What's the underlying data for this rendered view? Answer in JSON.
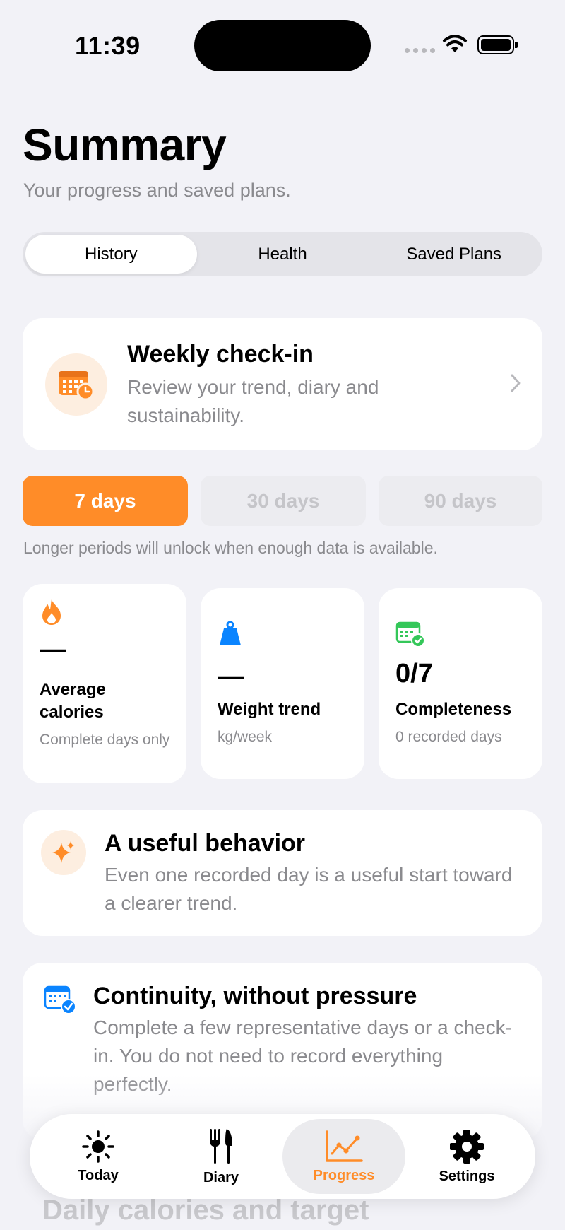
{
  "status_bar": {
    "time": "11:39"
  },
  "header": {
    "title": "Summary",
    "subtitle": "Your progress and saved plans."
  },
  "segments": [
    "History",
    "Health",
    "Saved Plans"
  ],
  "segment_selected": "History",
  "checkin": {
    "title": "Weekly check-in",
    "description": "Review your trend, diary and sustainability.",
    "icon": "calendar-clock-icon"
  },
  "periods": {
    "options": [
      "7 days",
      "30 days",
      "90 days"
    ],
    "selected": "7 days",
    "note": "Longer periods will unlock when enough data is available."
  },
  "stats": [
    {
      "icon": "flame-icon",
      "value": "—",
      "label": "Average calories",
      "sub": "Complete days only"
    },
    {
      "icon": "weight-icon",
      "value": "—",
      "label": "Weight trend",
      "sub": "kg/week"
    },
    {
      "icon": "calendar-check-icon",
      "value": "0/7",
      "label": "Completeness",
      "sub": "0 recorded days"
    }
  ],
  "behavior": {
    "title": "A useful behavior",
    "description": "Even one recorded day is a useful start toward a clearer trend.",
    "icon": "sparkles-icon"
  },
  "continuity": {
    "title": "Continuity, without pressure",
    "description": "Complete a few representative days or a check-in. You do not need to record everything perfectly.",
    "icon": "calendar-badge-icon"
  },
  "next_section_title": "Daily calories and target",
  "tabbar": {
    "items": [
      {
        "label": "Today",
        "icon": "sun-icon"
      },
      {
        "label": "Diary",
        "icon": "fork-knife-icon"
      },
      {
        "label": "Progress",
        "icon": "chart-icon"
      },
      {
        "label": "Settings",
        "icon": "gear-icon"
      }
    ],
    "active": "Progress"
  },
  "colors": {
    "accent": "#ff8c28",
    "background": "#f2f2f7",
    "secondary_text": "#8a8a8e",
    "blue": "#0a84ff",
    "green": "#34c759"
  }
}
